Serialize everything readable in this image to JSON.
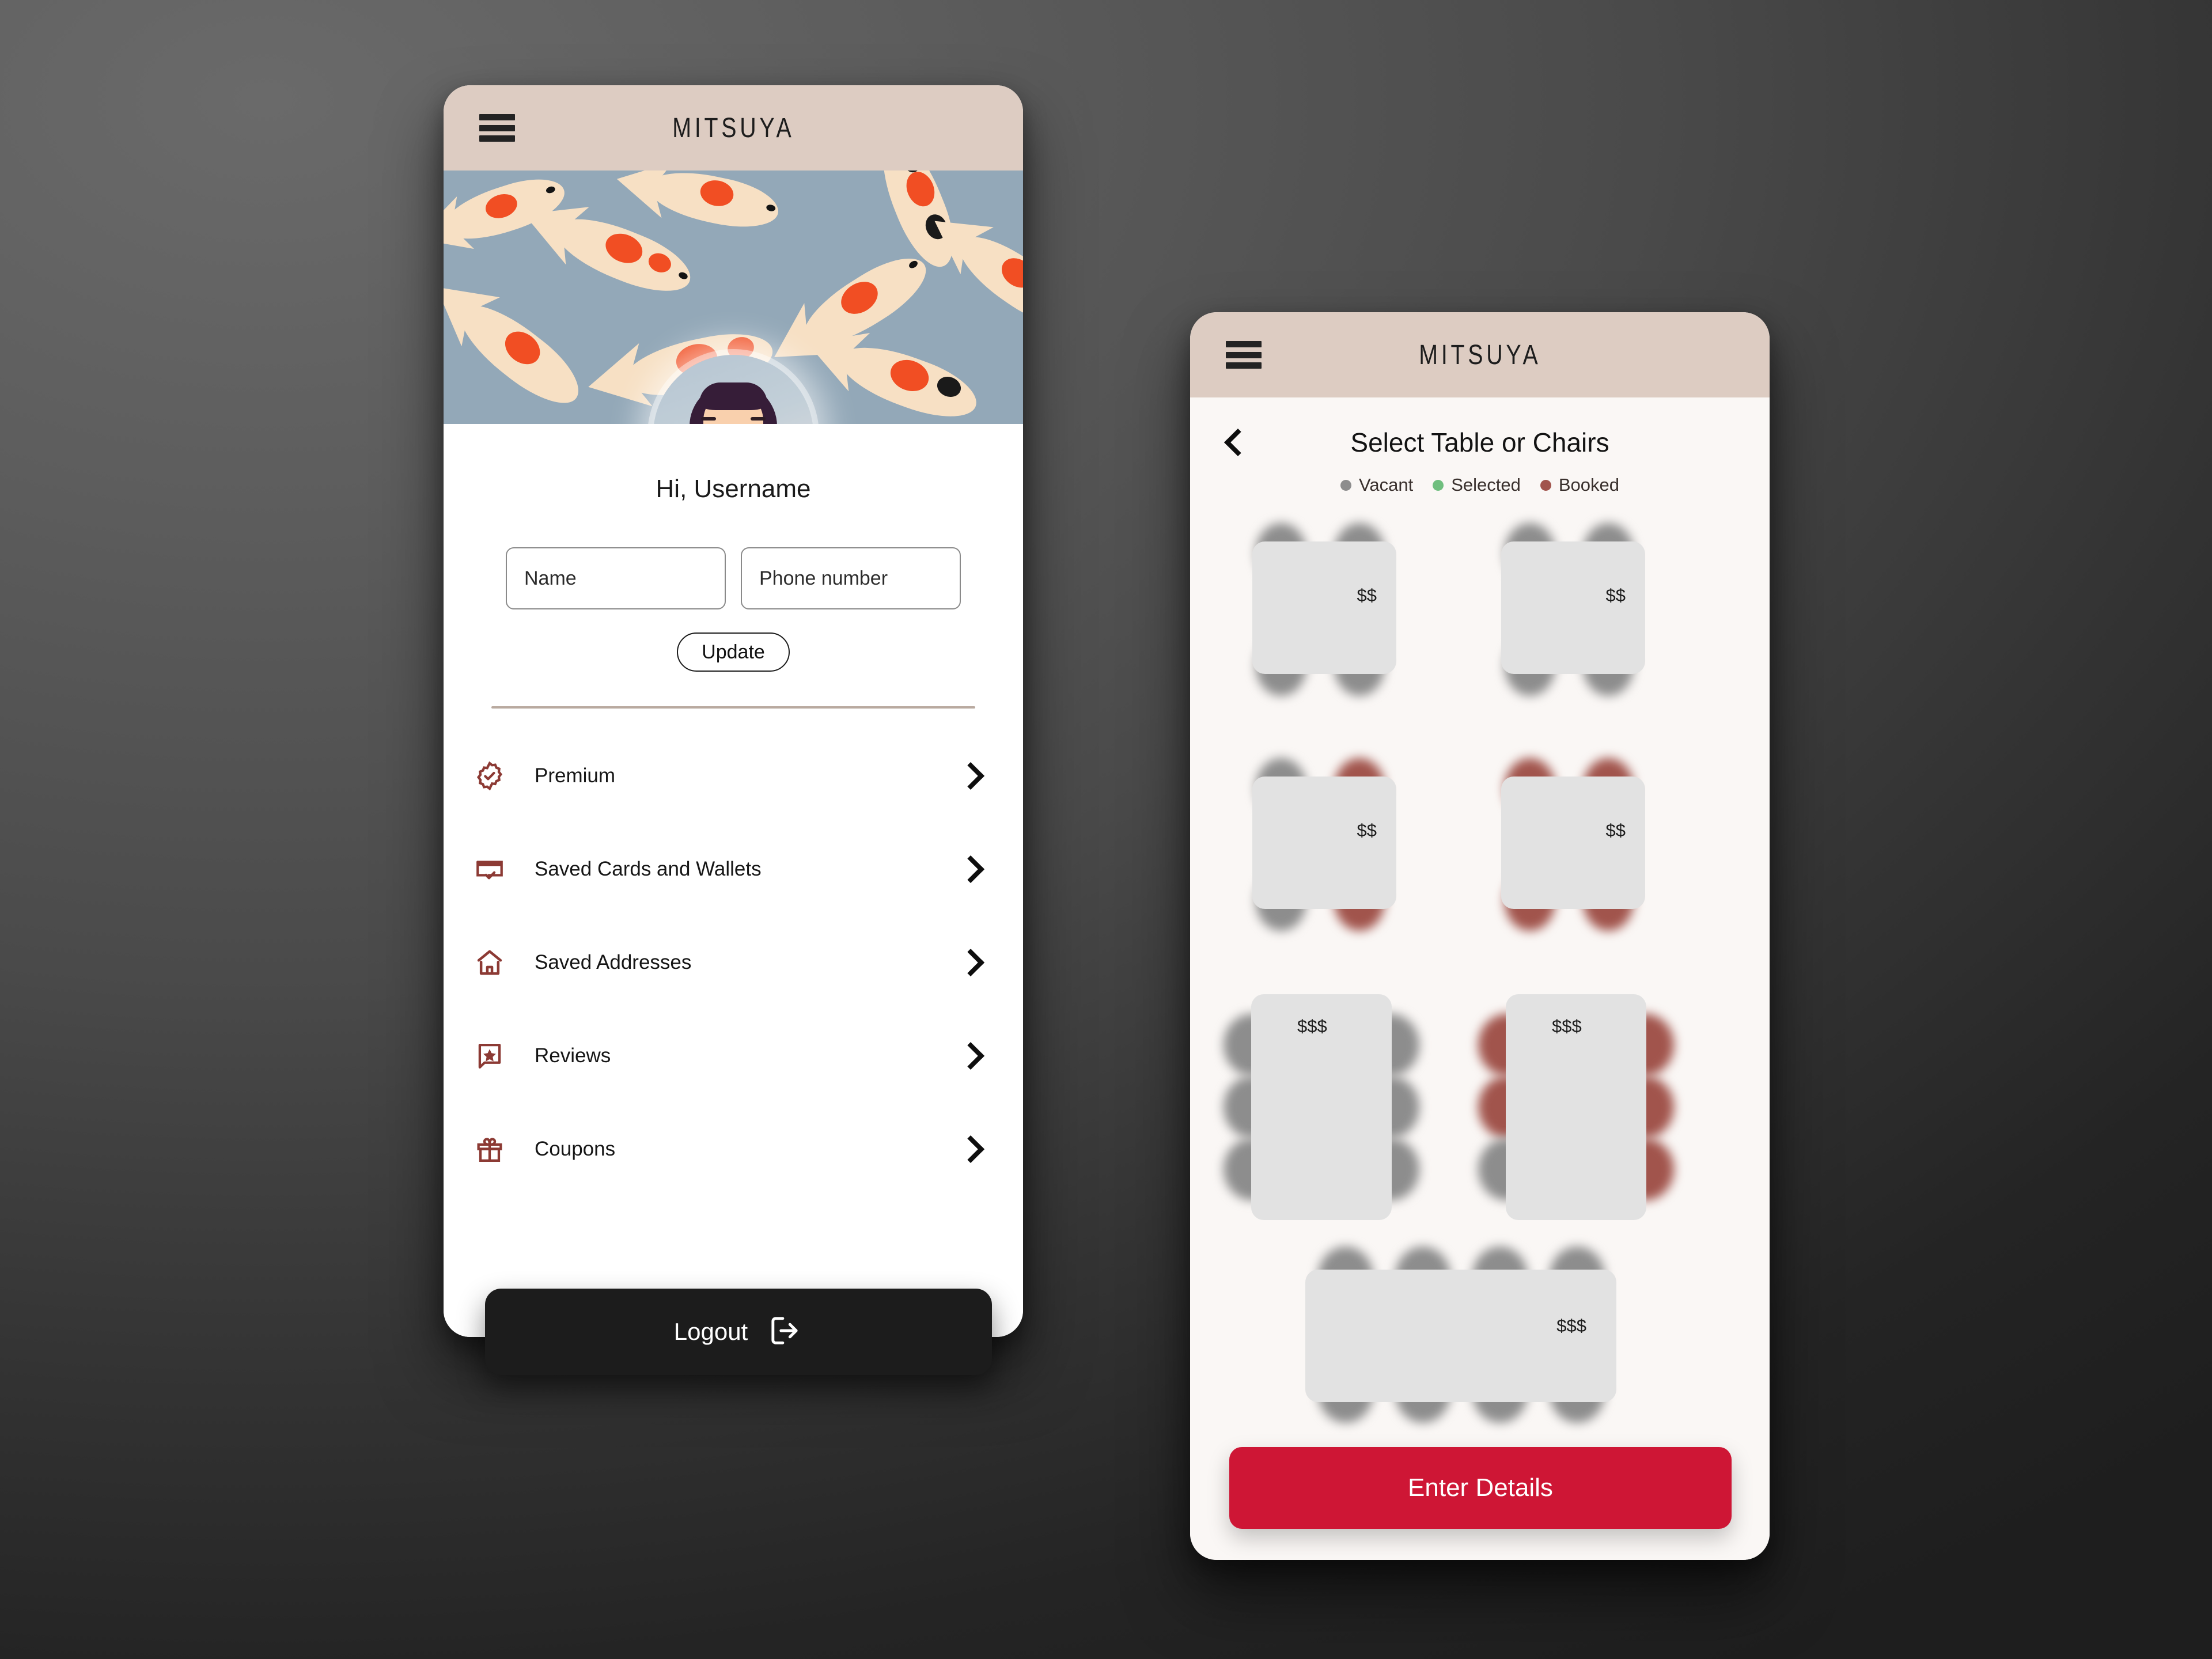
{
  "background": {
    "color_top_left": "#5C5C5C",
    "color_bottom_right": "#1E1E1E"
  },
  "theme": {
    "appbar_bg": "#DDCCC2",
    "screen_bg": "#FAF7F5",
    "accent_red": "#CE1635",
    "icon_maroon": "#8C3A34",
    "vacant": "#8D8D8D",
    "selected": "#6FBE7E",
    "booked": "#A1544C",
    "table_surface": "#E2E2E2",
    "logout_bg": "#1C1C1C",
    "koi_water": "#93A8B8",
    "koi_body": "#F7E0C4",
    "koi_spot": "#F14E23"
  },
  "profile_screen": {
    "appbar": {
      "title": "MITSUYA",
      "menu_icon": "hamburger-icon"
    },
    "banner": {
      "illustration": "koi-fish-pattern"
    },
    "avatar": {
      "icon": "user-avatar-illustration"
    },
    "greeting": "Hi, Username",
    "form": {
      "name_field": {
        "placeholder": "Name",
        "value": ""
      },
      "phone_field": {
        "placeholder": "Phone number",
        "value": ""
      },
      "update_label": "Update"
    },
    "menu_items": [
      {
        "label": "Premium",
        "icon": "badge-check-icon",
        "chevron": "chevron-right-icon"
      },
      {
        "label": "Saved Cards and Wallets",
        "icon": "credit-card-check-icon",
        "chevron": "chevron-right-icon"
      },
      {
        "label": "Saved Addresses",
        "icon": "home-icon",
        "chevron": "chevron-right-icon"
      },
      {
        "label": "Reviews",
        "icon": "star-bookmark-icon",
        "chevron": "chevron-right-icon"
      },
      {
        "label": "Coupons",
        "icon": "gift-icon",
        "chevron": "chevron-right-icon"
      }
    ],
    "logout": {
      "label": "Logout",
      "icon": "logout-arrow-icon"
    }
  },
  "tables_screen": {
    "appbar": {
      "title": "MITSUYA",
      "menu_icon": "hamburger-icon"
    },
    "back_icon": "chevron-left-icon",
    "title": "Select Table or Chairs",
    "legend": [
      {
        "label": "Vacant",
        "color": "#8D8D8D"
      },
      {
        "label": "Selected",
        "color": "#6FBE7E"
      },
      {
        "label": "Booked",
        "color": "#A1544C"
      }
    ],
    "tables": [
      {
        "id": "table-1",
        "price": "$$",
        "seats": 4,
        "layout": "2x2",
        "chairs": [
          "vacant",
          "vacant",
          "vacant",
          "vacant"
        ]
      },
      {
        "id": "table-2",
        "price": "$$",
        "seats": 4,
        "layout": "2x2",
        "chairs": [
          "vacant",
          "vacant",
          "vacant",
          "vacant"
        ]
      },
      {
        "id": "table-3",
        "price": "$$",
        "seats": 4,
        "layout": "2x2",
        "chairs": [
          "vacant",
          "booked",
          "vacant",
          "booked"
        ]
      },
      {
        "id": "table-4",
        "price": "$$",
        "seats": 4,
        "layout": "2x2",
        "chairs": [
          "booked",
          "booked",
          "booked",
          "booked"
        ]
      },
      {
        "id": "table-5",
        "price": "$$$",
        "seats": 6,
        "layout": "2x3",
        "chairs": [
          "vacant",
          "vacant",
          "vacant",
          "vacant",
          "vacant",
          "vacant"
        ]
      },
      {
        "id": "table-6",
        "price": "$$$",
        "seats": 6,
        "layout": "2x3",
        "chairs": [
          "booked",
          "booked",
          "booked",
          "booked",
          "vacant",
          "booked"
        ]
      },
      {
        "id": "table-7",
        "price": "$$$",
        "seats": 8,
        "layout": "4x2",
        "chairs": [
          "vacant",
          "vacant",
          "vacant",
          "vacant",
          "vacant",
          "vacant",
          "vacant",
          "vacant"
        ]
      }
    ],
    "cta": {
      "label": "Enter Details"
    }
  }
}
